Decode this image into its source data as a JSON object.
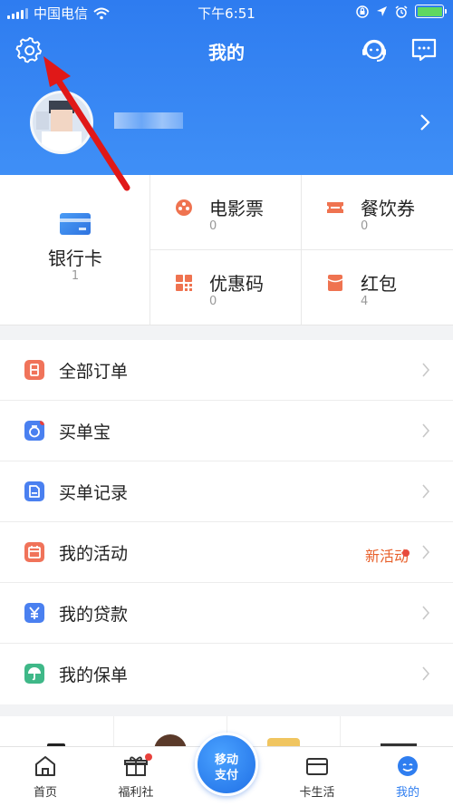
{
  "status_bar": {
    "carrier": "中国电信",
    "time": "下午6:51"
  },
  "header": {
    "title": "我的"
  },
  "cards": {
    "bank_card": {
      "label": "银行卡",
      "count": "1"
    },
    "movie": {
      "label": "电影票",
      "count": "0"
    },
    "dining": {
      "label": "餐饮券",
      "count": "0"
    },
    "coupon": {
      "label": "优惠码",
      "count": "0"
    },
    "redpacket": {
      "label": "红包",
      "count": "4"
    }
  },
  "menu": {
    "all_orders": "全部订单",
    "maidanbao": "买单宝",
    "pay_records": "买单记录",
    "my_activities": "我的活动",
    "new_activity": "新活动",
    "my_loans": "我的贷款",
    "my_policies": "我的保单"
  },
  "tabs": {
    "home": "首页",
    "welfare": "福利社",
    "pay_line1": "移动",
    "pay_line2": "支付",
    "card_life": "卡生活",
    "mine": "我的"
  },
  "colors": {
    "header_blue": "#2e7cf0",
    "accent_orange": "#e8612c",
    "active_tab": "#2f7ef0"
  }
}
